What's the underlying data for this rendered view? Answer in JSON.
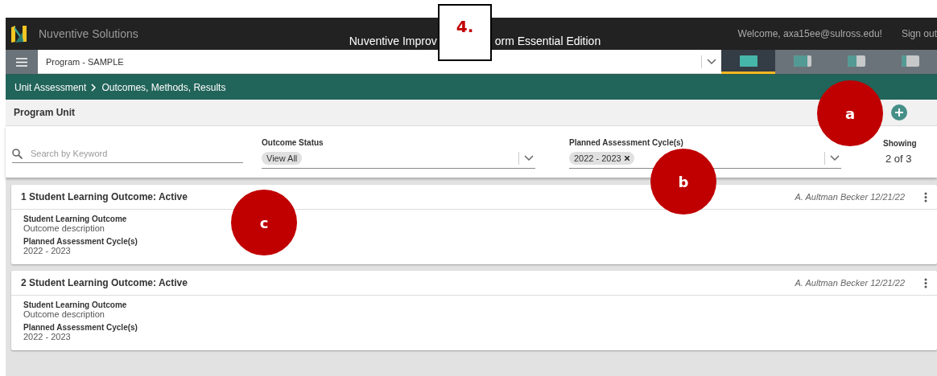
{
  "header": {
    "brand": "Nuventive Solutions",
    "title_parts": [
      "Nuventive Improv",
      "orm Essential Edition"
    ],
    "welcome": "Welcome, axa15ee@sulross.edu!",
    "sign_out": "Sign out"
  },
  "program_bar": {
    "value": "Program - SAMPLE"
  },
  "view_tabs": [
    {
      "kind": "full",
      "selected": true
    },
    {
      "kind": "wide",
      "selected": false
    },
    {
      "kind": "half",
      "selected": false
    },
    {
      "kind": "narrow",
      "selected": false
    }
  ],
  "breadcrumb": [
    "Unit Assessment",
    "Outcomes, Methods, Results"
  ],
  "section": {
    "title": "Program Unit"
  },
  "filters": {
    "search": {
      "placeholder": "Search by Keyword"
    },
    "outcome_status": {
      "label": "Outcome Status",
      "chips": [
        "View All"
      ]
    },
    "cycles": {
      "label": "Planned Assessment Cycle(s)",
      "chips": [
        "2022 - 2023"
      ]
    },
    "showing_label": "Showing",
    "showing_count": "2 of 3"
  },
  "cards": [
    {
      "title": "1 Student Learning Outcome: Active",
      "meta": "A. Aultman Becker 12/21/22",
      "fields": [
        {
          "label": "Student Learning Outcome",
          "value": "Outcome description"
        },
        {
          "label": "Planned Assessment Cycle(s)",
          "value": "2022 - 2023"
        }
      ]
    },
    {
      "title": "2 Student Learning Outcome: Active",
      "meta": "A. Aultman Becker 12/21/22",
      "fields": [
        {
          "label": "Student Learning Outcome",
          "value": "Outcome description"
        },
        {
          "label": "Planned Assessment Cycle(s)",
          "value": "2022 - 2023"
        }
      ]
    }
  ],
  "callouts": [
    {
      "kind": "box",
      "label": "4."
    },
    {
      "kind": "circle",
      "label": "a"
    },
    {
      "kind": "circle",
      "label": "b"
    },
    {
      "kind": "circle",
      "label": "c"
    }
  ]
}
